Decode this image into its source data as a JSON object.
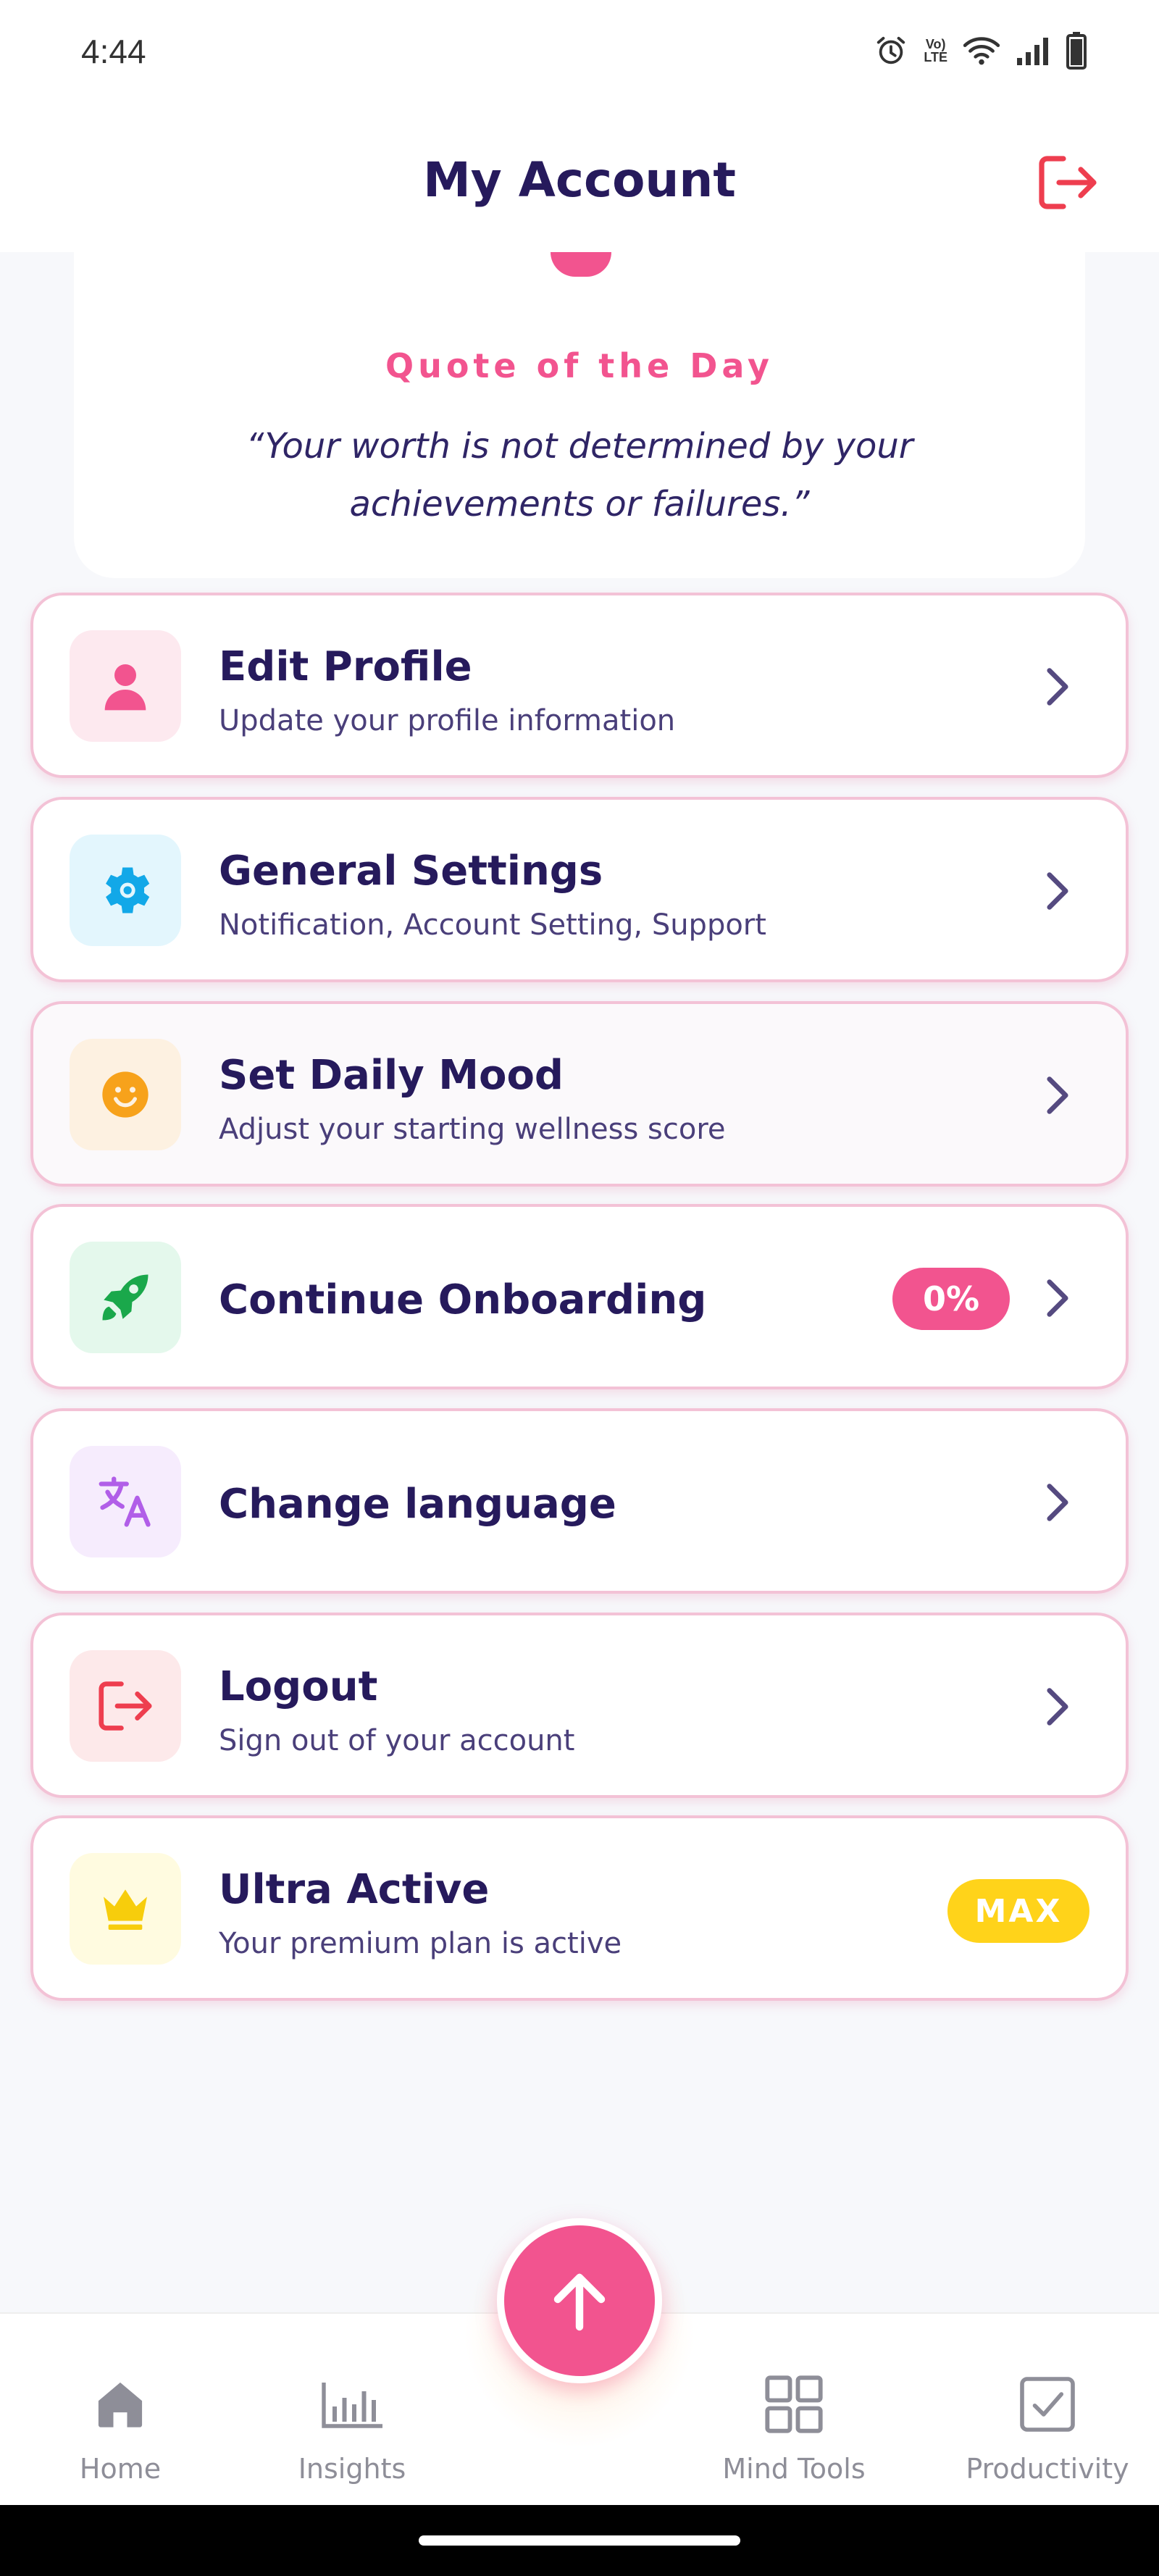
{
  "status_bar": {
    "time": "4:44",
    "lte_top": "Vo)",
    "lte_bottom": "LTE"
  },
  "header": {
    "title": "My Account",
    "logout_icon": "logout-icon"
  },
  "quote": {
    "heading": "Quote of the Day",
    "text": "“Your worth is not determined by your achievements or failures.”"
  },
  "menu": [
    {
      "title": "Edit Profile",
      "subtitle": "Update your profile information",
      "icon": "user-icon",
      "icon_bg": "#fde9ef",
      "icon_color": "#f2548f"
    },
    {
      "title": "General Settings",
      "subtitle": "Notification, Account Setting, Support",
      "icon": "gear-icon",
      "icon_bg": "#e3f6fd",
      "icon_color": "#12a8e8"
    },
    {
      "title": "Set Daily Mood",
      "subtitle": "Adjust your starting wellness score",
      "icon": "smiley-icon",
      "icon_bg": "#fdf1e1",
      "icon_color": "#f7a21b"
    },
    {
      "title": "Continue Onboarding",
      "badge": "0%",
      "icon": "rocket-icon",
      "icon_bg": "#e4f8ec",
      "icon_color": "#1aa84b"
    },
    {
      "title": "Change language",
      "icon": "translate-icon",
      "icon_bg": "#f6ecfd",
      "icon_color": "#b15ee8"
    },
    {
      "title": "Logout",
      "subtitle": "Sign out of your account",
      "icon": "logout-icon",
      "icon_bg": "#fde9ea",
      "icon_color": "#ee3e4f"
    },
    {
      "title": "Ultra Active",
      "subtitle": "Your premium plan is active",
      "badge": "MAX",
      "icon": "crown-icon",
      "icon_bg": "#fffbe0",
      "icon_color": "#f7cd0c"
    }
  ],
  "nav": {
    "home": "Home",
    "insights": "Insights",
    "mind_tools": "Mind Tools",
    "productivity": "Productivity"
  },
  "colors": {
    "accent_pink": "#f2548f",
    "title_navy": "#261a5c",
    "badge_yellow": "#ffd31a",
    "nav_gray": "#8e8e98"
  }
}
